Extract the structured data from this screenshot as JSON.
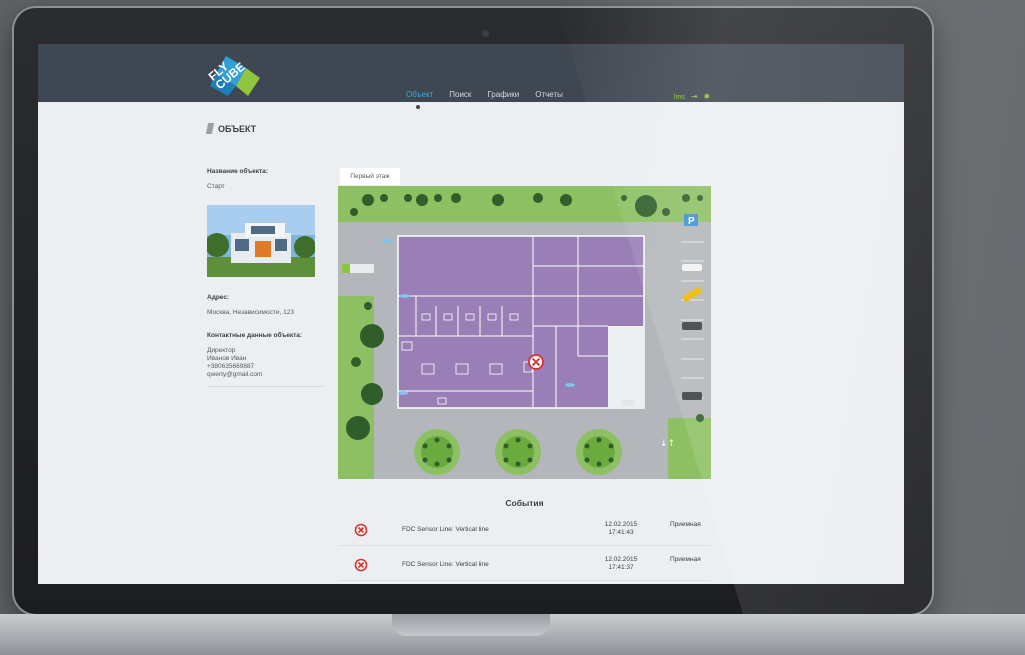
{
  "header": {
    "logo_line1": "FLY",
    "logo_line2": "CUBE",
    "nav": [
      {
        "label": "Объект",
        "active": true
      },
      {
        "label": "Поиск"
      },
      {
        "label": "Графики"
      },
      {
        "label": "Отчеты"
      }
    ],
    "user": "lms"
  },
  "page": {
    "title": "ОБЪЕКТ"
  },
  "object": {
    "name_label": "Название объекта:",
    "name": "Старт",
    "address_label": "Адрес:",
    "address": "Москва, Независимости, 123",
    "contacts_label": "Контактные данные объекта:",
    "contact_role": "Директор",
    "contact_name": "Иванов Иван",
    "contact_phone": "+380635669887",
    "contact_email": "qwerty@gmail.com"
  },
  "floor_tab": "Первый этаж",
  "events": {
    "title": "События",
    "rows": [
      {
        "name": "FDC Sensor Line: Vertical line",
        "date": "12.02.2015",
        "time": "17:41:43",
        "location": "Приемная"
      },
      {
        "name": "FDC Sensor Line: Vertical line",
        "date": "12.02.2015",
        "time": "17:41:37",
        "location": "Приемная"
      }
    ]
  },
  "colors": {
    "header_bg": "#3f4752",
    "accent": "#3ea8e0",
    "user_green": "#8ec63f",
    "room_purple": "#9a7fb6",
    "lawn_green": "#8cc063",
    "alarm_red": "#d9302f"
  }
}
